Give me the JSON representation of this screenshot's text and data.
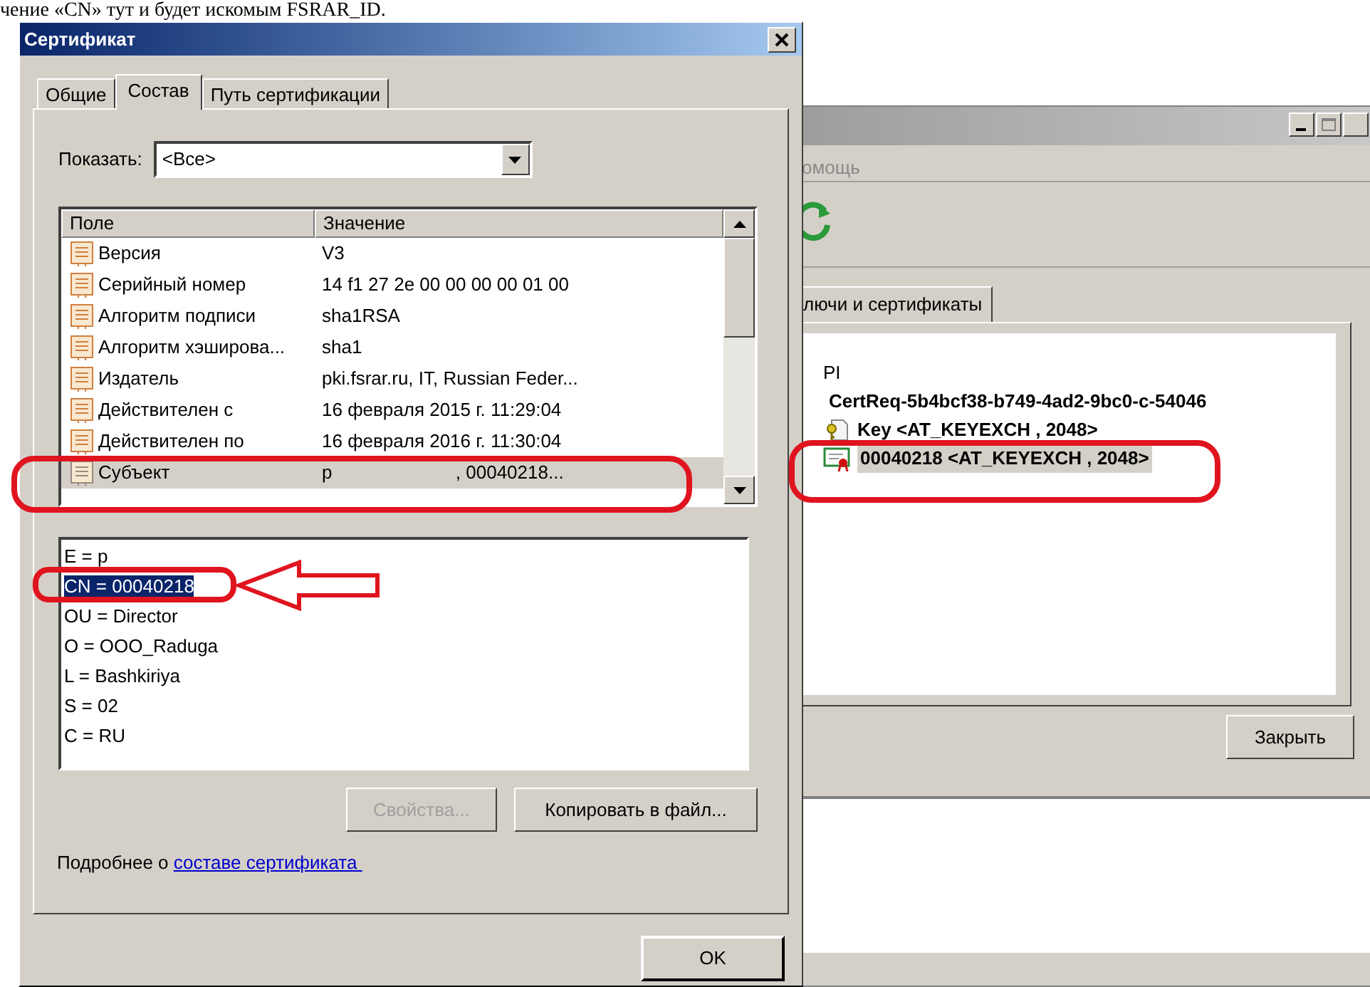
{
  "document_text": "чение «CN» тут и будет искомым FSRAR_ID.",
  "background_window": {
    "menu_item": "омощь",
    "tab": "лючи и сертификаты",
    "tree": [
      {
        "label": "PI",
        "children": [
          {
            "label": "CertReq-5b4bcf38-b749-4ad2-9bc0-c-54046",
            "children": [
              {
                "kind": "key",
                "label": "Key <AT_KEYEXCH , 2048>",
                "selected": false
              },
              {
                "kind": "certificate",
                "label": "00040218 <AT_KEYEXCH , 2048>",
                "selected": true
              }
            ]
          }
        ]
      }
    ],
    "close_button": "Закрыть"
  },
  "cert_dialog": {
    "title": "Сертификат",
    "tabs": [
      {
        "label": "Общие",
        "selected": false
      },
      {
        "label": "Состав",
        "selected": true
      },
      {
        "label": "Путь сертификации",
        "selected": false
      }
    ],
    "show_label": "Показать:",
    "show_value": "<Все>",
    "columns": [
      "Поле",
      "Значение"
    ],
    "fields": [
      {
        "field": "Версия",
        "value": "V3",
        "selected": false
      },
      {
        "field": "Серийный номер",
        "value": "14 f1 27 2e 00 00 00 00 01 00",
        "selected": false
      },
      {
        "field": "Алгоритм подписи",
        "value": "sha1RSA",
        "selected": false
      },
      {
        "field": "Алгоритм хэширова...",
        "value": "sha1",
        "selected": false
      },
      {
        "field": "Издатель",
        "value": "pki.fsrar.ru, IT, Russian Feder...",
        "selected": false
      },
      {
        "field": "Действителен с",
        "value": "16 февраля 2015 г. 11:29:04",
        "selected": false
      },
      {
        "field": "Действителен по",
        "value": "16 февраля 2016 г. 11:30:04",
        "selected": false
      },
      {
        "field": "Субъект",
        "value": "p                        , 00040218...",
        "selected": true
      }
    ],
    "detail_lines": [
      {
        "text": "E = p",
        "selected": false
      },
      {
        "text": "CN = 00040218",
        "selected": true
      },
      {
        "text": "OU = Director",
        "selected": false
      },
      {
        "text": "O = OOO_Raduga",
        "selected": false
      },
      {
        "text": "L = Bashkiriya",
        "selected": false
      },
      {
        "text": "S = 02",
        "selected": false
      },
      {
        "text": "C = RU",
        "selected": false
      }
    ],
    "buttons": [
      {
        "label": "Свойства...",
        "disabled": true
      },
      {
        "label": "Копировать в файл...",
        "disabled": false
      }
    ],
    "more_text": "Подробнее о ",
    "more_link": "составе сертификата ",
    "ok_button": "OK"
  }
}
